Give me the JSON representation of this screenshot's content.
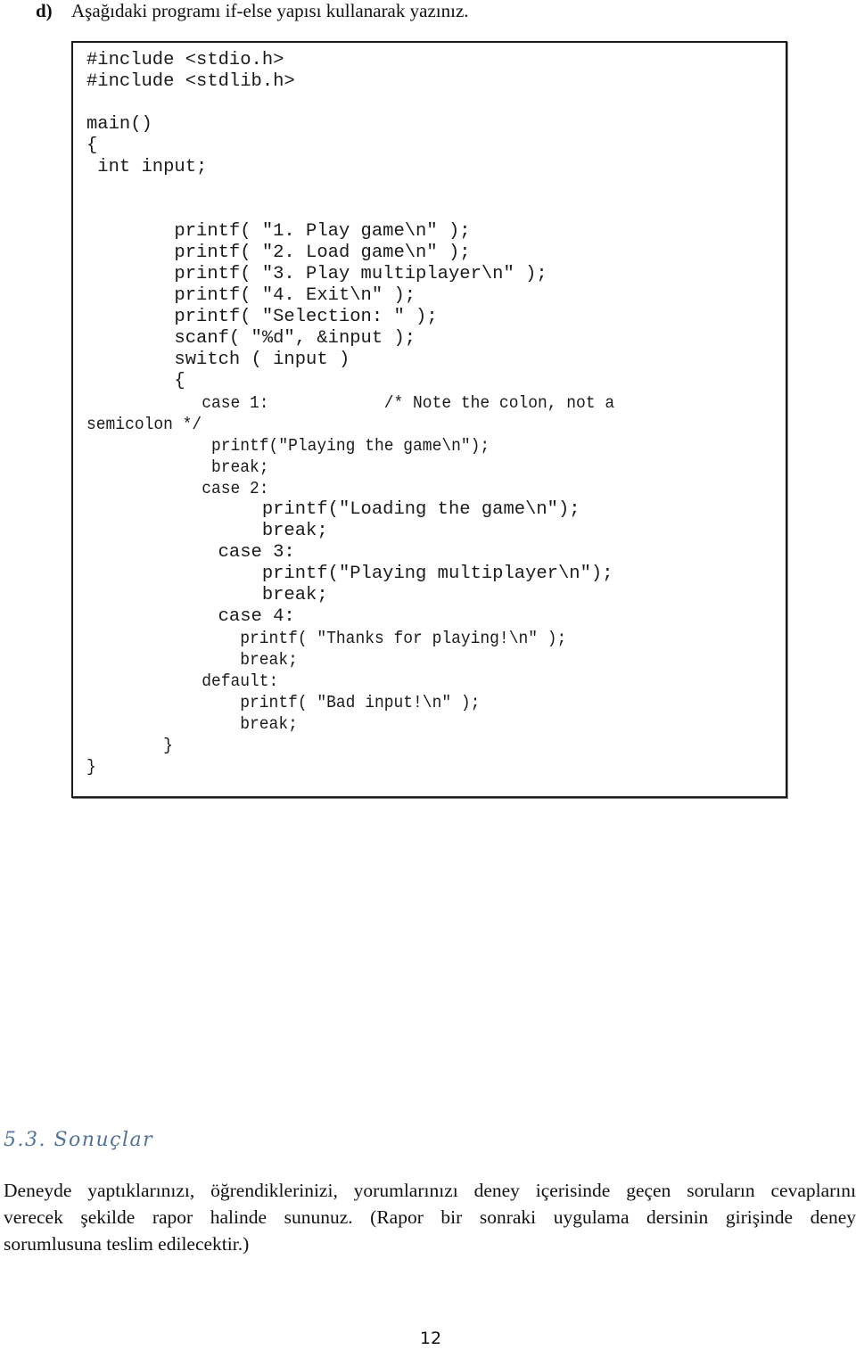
{
  "question": {
    "label": "d)",
    "text": "Aşağıdaki programı if-else yapısı kullanarak yazınız."
  },
  "code": {
    "lines": [
      "#include <stdio.h>",
      "#include <stdlib.h>",
      "",
      "main()",
      "{",
      " int input;",
      "",
      "",
      "        printf( \"1. Play game\\n\" );",
      "        printf( \"2. Load game\\n\" );",
      "        printf( \"3. Play multiplayer\\n\" );",
      "        printf( \"4. Exit\\n\" );",
      "        printf( \"Selection: \" );",
      "        scanf( \"%d\", &input );",
      "        switch ( input )",
      "        {",
      "            case 1:            /* Note the colon, not a",
      "semicolon */",
      "             printf(\"Playing the game\\n\");",
      "             break;",
      "            case 2:",
      "                printf(\"Loading the game\\n\");",
      "                break;",
      "            case 3:",
      "                printf(\"Playing multiplayer\\n\");",
      "                break;",
      "            case 4:",
      "                printf( \"Thanks for playing!\\n\" );",
      "                break;",
      "            default:",
      "                printf( \"Bad input!\\n\" );",
      "                break;",
      "        }",
      "}"
    ]
  },
  "section": {
    "heading": "5.3. Sonuçlar",
    "paragraph_lines": [
      "Deneyde yaptıklarınızı, öğrendiklerinizi, yorumlarınızı deney içerisinde geçen soruların cevaplarını",
      "verecek şekilde rapor halinde sununuz. (Rapor bir sonraki uygulama dersinin girişinde deney",
      "sorumlusuna teslim edilecektir.)"
    ]
  },
  "page_number": "12"
}
